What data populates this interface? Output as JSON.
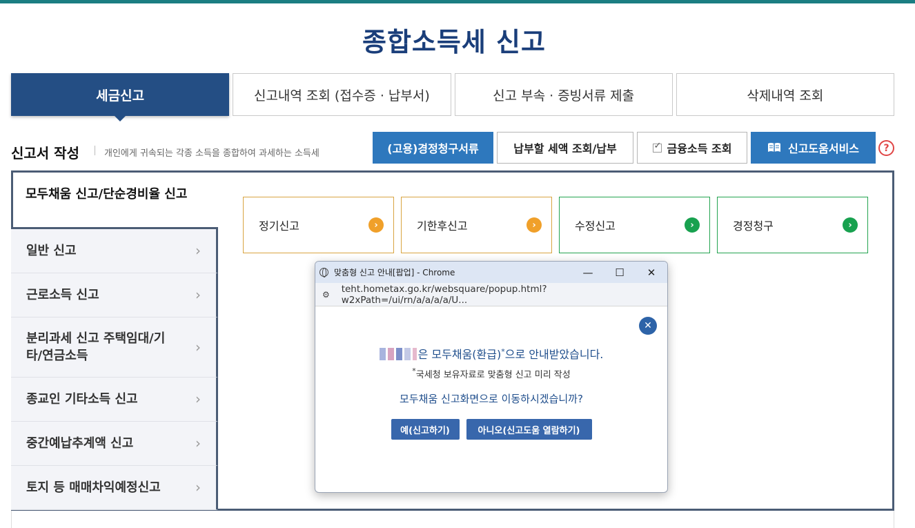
{
  "page": {
    "title": "종합소득세 신고"
  },
  "tabs": [
    {
      "label": "세금신고",
      "active": true
    },
    {
      "label": "신고내역 조회 (접수증 · 납부서)",
      "active": false
    },
    {
      "label": "신고 부속 · 증빙서류 제출",
      "active": false
    },
    {
      "label": "삭제내역 조회",
      "active": false
    }
  ],
  "section": {
    "title": "신고서 작성",
    "description": "개인에게 귀속되는 각종 소득을 종합하여 과세하는 소득세"
  },
  "actions": {
    "claim_label": "(고용)경정청구서류",
    "payment_label": "납부할 세액 조회/납부",
    "finance_label": "금융소득 조회",
    "help_service_label": "신고도움서비스",
    "help_icon": "?"
  },
  "menu": {
    "active": "모두채움 신고/단순경비율 신고",
    "items": [
      {
        "label": "일반 신고"
      },
      {
        "label": "근로소득 신고"
      },
      {
        "label": "분리과세 신고 주택임대/기타/연금소득"
      },
      {
        "label": "종교인 기타소득 신고"
      },
      {
        "label": "중간예납추계액 신고"
      },
      {
        "label": "토지 등 매매차익예정신고"
      }
    ]
  },
  "cards": [
    {
      "label": "정기신고",
      "color": "#f0a02a"
    },
    {
      "label": "기한후신고",
      "color": "#f0a02a"
    },
    {
      "label": "수정신고",
      "color": "#18a14f"
    },
    {
      "label": "경정청구",
      "color": "#18a14f"
    }
  ],
  "popup": {
    "window_title": "맞춤형 신고 안내[팝업] - Chrome",
    "url": "teht.hometax.go.kr/websquare/popup.html?w2xPath=/ui/rn/a/a/a/a/U...",
    "message_line1": "은 모두채움(환급)",
    "message_line1_sup": "*",
    "message_line1_tail": "으로 안내받았습니다.",
    "note_sup": "*",
    "note": "국세청 보유자료로 맞춤형 신고 미리 작성",
    "question": "모두채움 신고화면으로 이동하시겠습니까?",
    "yes_label": "예(신고하기)",
    "no_label": "아니오(신고도움 열람하기)"
  }
}
